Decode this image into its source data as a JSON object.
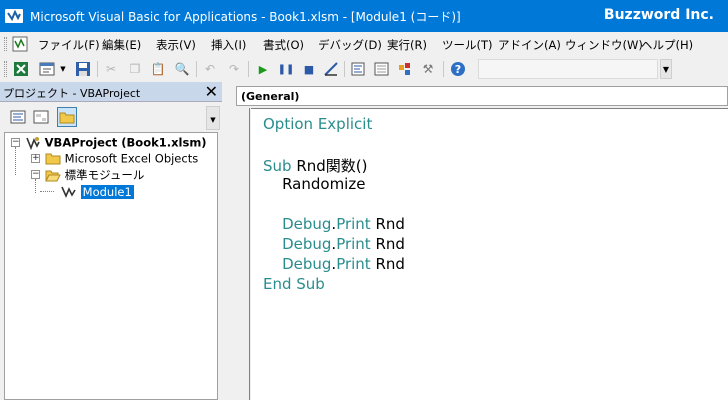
{
  "titlebar": {
    "title": "Microsoft Visual Basic for Applications - Book1.xlsm - [Module1 (コード)]",
    "brand": "Buzzword Inc.",
    "icon": "vba-app-icon",
    "color": "#0078d7"
  },
  "menu": {
    "items": [
      "ファイル(F)",
      "編集(E)",
      "表示(V)",
      "挿入(I)",
      "書式(O)",
      "デバッグ(D)",
      "実行(R)",
      "ツール(T)",
      "アドイン(A)",
      "ウィンドウ(W)",
      "ヘルプ(H)"
    ]
  },
  "toolbar": {
    "icons": [
      "view-excel-icon",
      "insert-module-icon",
      "dropdown-arrow-icon",
      "save-icon",
      "cut-icon",
      "copy-icon",
      "paste-icon",
      "find-icon",
      "undo-icon",
      "redo-icon",
      "run-icon",
      "break-icon",
      "reset-icon",
      "design-mode-icon",
      "project-explorer-icon",
      "properties-icon",
      "object-browser-icon",
      "toolbox-icon",
      "help-icon"
    ]
  },
  "project": {
    "header": "プロジェクト - VBAProject",
    "tree": {
      "root": "VBAProject (Book1.xlsm)",
      "excel_objects": "Microsoft Excel Objects",
      "modules_folder": "標準モジュール",
      "module1": "Module1"
    }
  },
  "code": {
    "object_combo": "(General)",
    "lines": [
      {
        "kw": "Option Explicit",
        "rest": ""
      },
      {
        "kw": "",
        "rest": ""
      },
      {
        "kw": "Sub",
        "rest": " Rnd関数()"
      },
      {
        "kw": "",
        "rest": "    Randomize"
      },
      {
        "kw": "",
        "rest": ""
      },
      {
        "kw": "    Debug",
        "dot": ".",
        "kw2": "Print",
        "rest": " Rnd"
      },
      {
        "kw": "    Debug",
        "dot": ".",
        "kw2": "Print",
        "rest": " Rnd"
      },
      {
        "kw": "    Debug",
        "dot": ".",
        "kw2": "Print",
        "rest": " Rnd"
      },
      {
        "kw": "End Sub",
        "rest": ""
      }
    ],
    "keyword_color": "#2a8d8d"
  }
}
